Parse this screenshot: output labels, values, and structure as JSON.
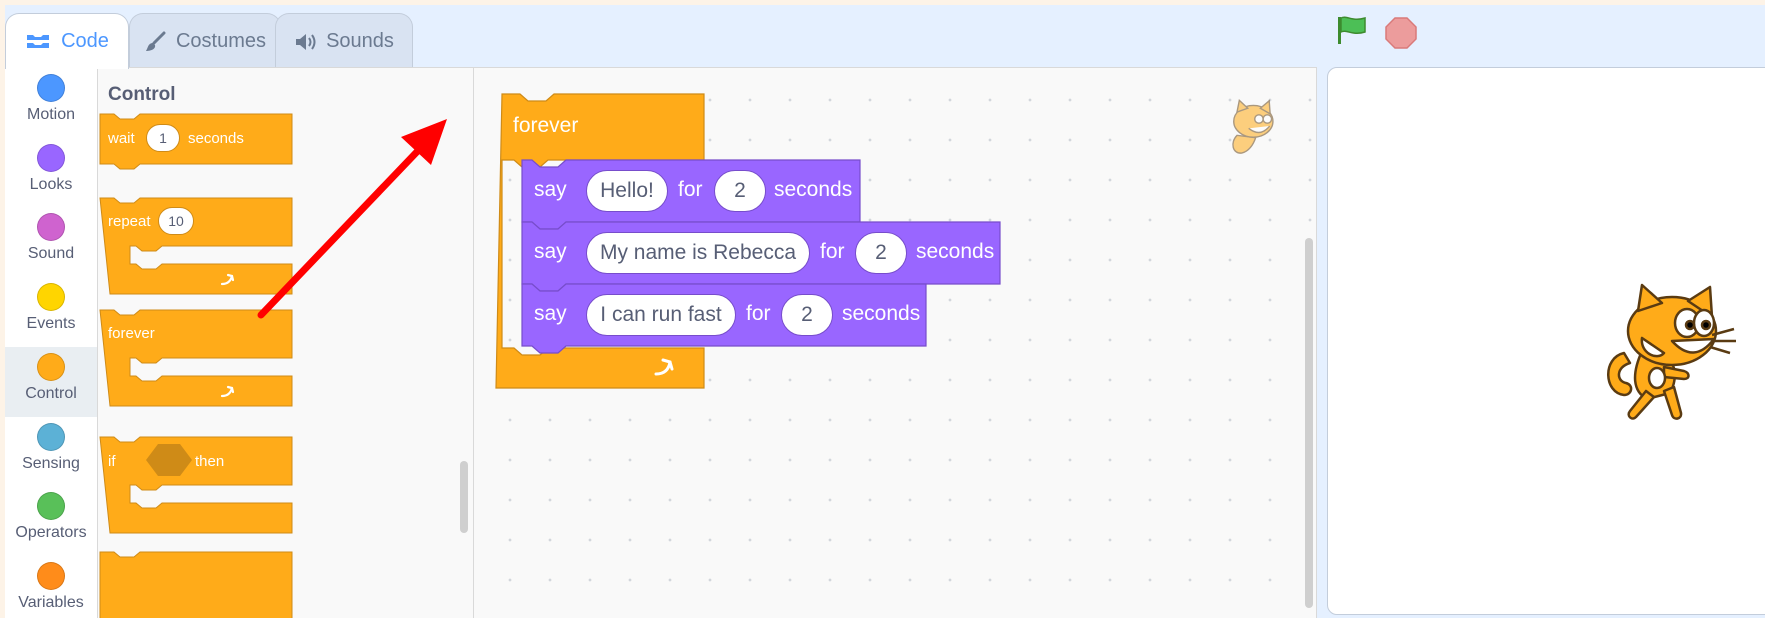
{
  "tabs": [
    {
      "label": "Code",
      "icon": "code-icon",
      "active": true
    },
    {
      "label": "Costumes",
      "icon": "brush-icon",
      "active": false
    },
    {
      "label": "Sounds",
      "icon": "speaker-icon",
      "active": false
    }
  ],
  "categories": [
    {
      "label": "Motion",
      "color": "#4c97ff"
    },
    {
      "label": "Looks",
      "color": "#9966ff"
    },
    {
      "label": "Sound",
      "color": "#cf63cf"
    },
    {
      "label": "Events",
      "color": "#ffd500"
    },
    {
      "label": "Control",
      "color": "#ffab19",
      "selected": true
    },
    {
      "label": "Sensing",
      "color": "#5cb1d6"
    },
    {
      "label": "Operators",
      "color": "#59c059"
    },
    {
      "label": "Variables",
      "color": "#ff8c1a"
    }
  ],
  "palette": {
    "title": "Control",
    "wait": {
      "word": "wait",
      "value": "1",
      "unit": "seconds"
    },
    "repeat": {
      "word": "repeat",
      "value": "10"
    },
    "forever": {
      "word": "forever"
    },
    "if_then": {
      "word": "if",
      "then": "then"
    }
  },
  "script": {
    "forever_label": "forever",
    "say_blocks": [
      {
        "say": "say",
        "message": "Hello!",
        "for": "for",
        "secs": "2",
        "unit": "seconds"
      },
      {
        "say": "say",
        "message": "My name is Rebecca",
        "for": "for",
        "secs": "2",
        "unit": "seconds"
      },
      {
        "say": "say",
        "message": "I can run fast",
        "for": "for",
        "secs": "2",
        "unit": "seconds"
      }
    ]
  },
  "colors": {
    "control": "#ffab19",
    "control_edge": "#cf8b17",
    "looks": "#9966ff",
    "looks_edge": "#774dcb",
    "annotation_arrow": "#ff0000"
  }
}
